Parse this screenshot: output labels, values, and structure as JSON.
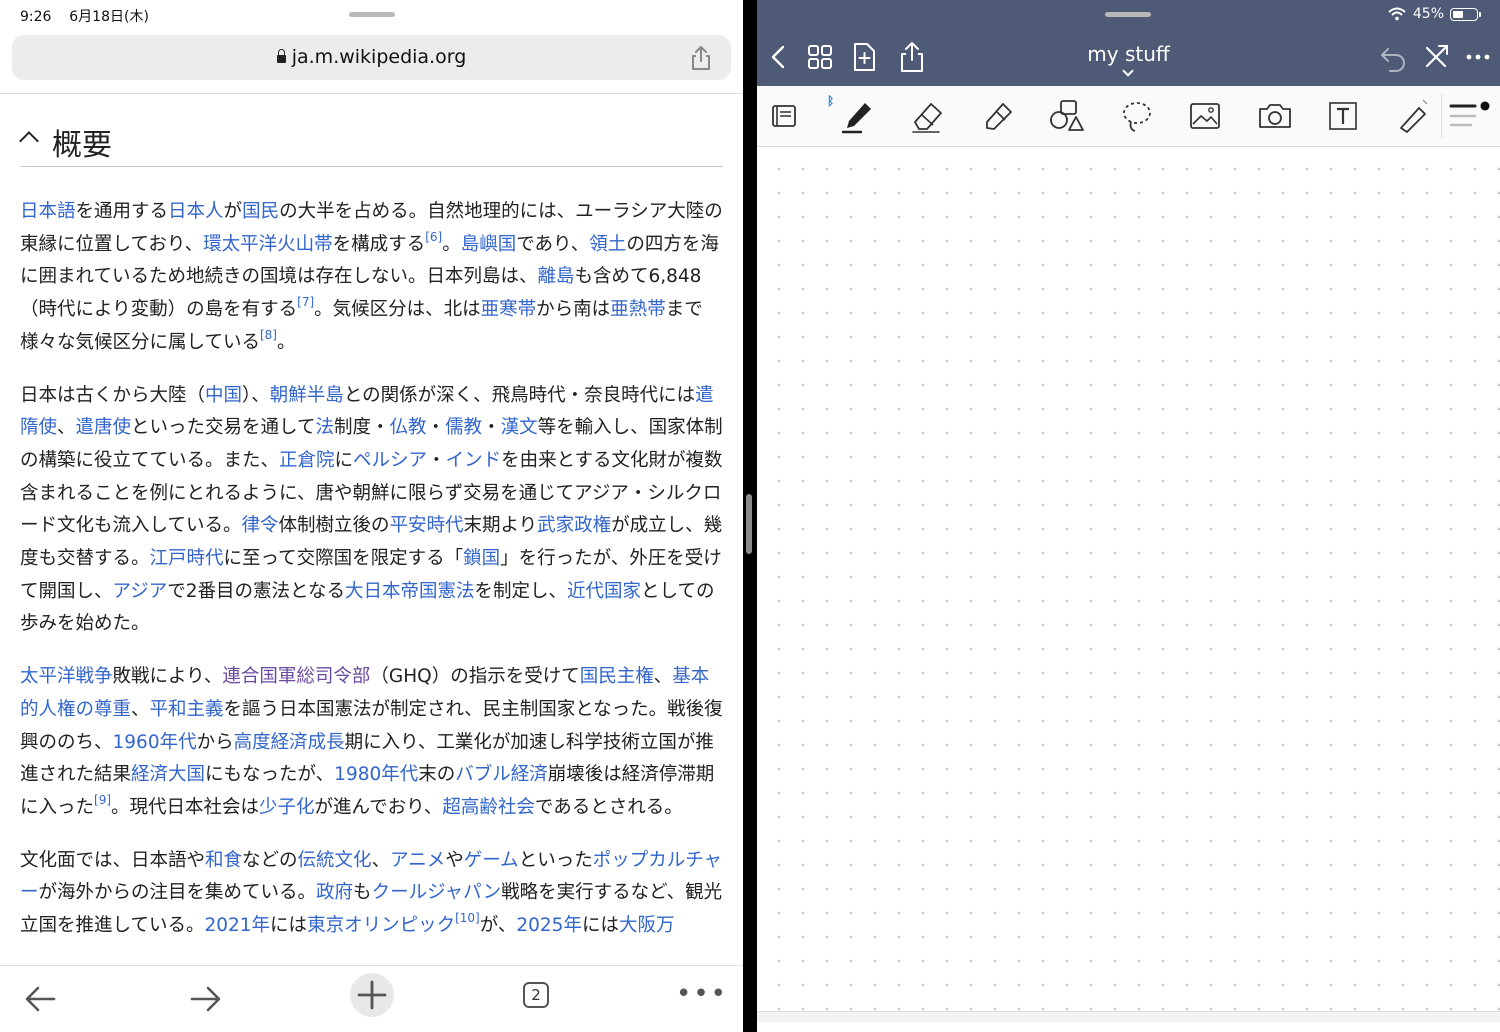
{
  "status": {
    "time": "9:26",
    "date": "6月18日(木)",
    "battery": "45%",
    "battery_level": 0.45
  },
  "browser": {
    "url": "ja.m.wikipedia.org",
    "section_title": "概要",
    "tab_count": "2",
    "paragraphs": [
      [
        {
          "t": "日本語",
          "link": true
        },
        {
          "t": "を通用する"
        },
        {
          "t": "日本人",
          "link": true
        },
        {
          "t": "が"
        },
        {
          "t": "国民",
          "link": true
        },
        {
          "t": "の大半を占める。自然地理的には、ユーラシア大陸の東縁に位置しており、"
        },
        {
          "t": "環太平洋火山帯",
          "link": true
        },
        {
          "t": "を構成する"
        },
        {
          "t": "[6]",
          "sup": true
        },
        {
          "t": "。"
        },
        {
          "t": "島嶼国",
          "link": true
        },
        {
          "t": "であり、"
        },
        {
          "t": "領土",
          "link": true
        },
        {
          "t": "の四方を海に囲まれているため地続きの国境は存在しない。日本列島は、"
        },
        {
          "t": "離島",
          "link": true
        },
        {
          "t": "も含めて6,848（時代により変動）の島を有する"
        },
        {
          "t": "[7]",
          "sup": true
        },
        {
          "t": "。気候区分は、北は"
        },
        {
          "t": "亜寒帯",
          "link": true
        },
        {
          "t": "から南は"
        },
        {
          "t": "亜熱帯",
          "link": true
        },
        {
          "t": "まで様々な気候区分に属している"
        },
        {
          "t": "[8]",
          "sup": true
        },
        {
          "t": "。"
        }
      ],
      [
        {
          "t": "日本は古くから大陸（"
        },
        {
          "t": "中国",
          "link": true
        },
        {
          "t": "）、"
        },
        {
          "t": "朝鮮半島",
          "link": true
        },
        {
          "t": "との関係が深く、飛鳥時代・奈良時代には"
        },
        {
          "t": "遣隋使",
          "link": true
        },
        {
          "t": "、"
        },
        {
          "t": "遣唐使",
          "link": true
        },
        {
          "t": "といった交易を通して"
        },
        {
          "t": "法",
          "link": true
        },
        {
          "t": "制度・"
        },
        {
          "t": "仏教",
          "link": true
        },
        {
          "t": "・"
        },
        {
          "t": "儒教",
          "link": true
        },
        {
          "t": "・"
        },
        {
          "t": "漢文",
          "link": true
        },
        {
          "t": "等を輸入し、国家体制の構築に役立てている。また、"
        },
        {
          "t": "正倉院",
          "link": true
        },
        {
          "t": "に"
        },
        {
          "t": "ペルシア",
          "link": true
        },
        {
          "t": "・"
        },
        {
          "t": "インド",
          "link": true
        },
        {
          "t": "を由来とする文化財が複数含まれることを例にとれるように、唐や朝鮮に限らず交易を通じてアジア・シルクロード文化も流入している。"
        },
        {
          "t": "律令",
          "link": true
        },
        {
          "t": "体制樹立後の"
        },
        {
          "t": "平安時代",
          "link": true
        },
        {
          "t": "末期より"
        },
        {
          "t": "武家政権",
          "link": true
        },
        {
          "t": "が成立し、幾度も交替する。"
        },
        {
          "t": "江戸時代",
          "link": true
        },
        {
          "t": "に至って交際国を限定する「"
        },
        {
          "t": "鎖国",
          "link": true
        },
        {
          "t": "」を行ったが、外圧を受けて開国し、"
        },
        {
          "t": "アジア",
          "link": true
        },
        {
          "t": "で2番目の憲法となる"
        },
        {
          "t": "大日本帝国憲法",
          "link": true
        },
        {
          "t": "を制定し、"
        },
        {
          "t": "近代国家",
          "link": true
        },
        {
          "t": "としての歩みを始めた。"
        }
      ],
      [
        {
          "t": "太平洋戦争",
          "link": true
        },
        {
          "t": "敗戦により、"
        },
        {
          "t": "連合国軍総司令部",
          "link": true,
          "visited": true
        },
        {
          "t": "（GHQ）の指示を受けて"
        },
        {
          "t": "国民主権",
          "link": true
        },
        {
          "t": "、"
        },
        {
          "t": "基本的人権の尊重",
          "link": true
        },
        {
          "t": "、"
        },
        {
          "t": "平和主義",
          "link": true
        },
        {
          "t": "を謳う日本国憲法が制定され、民主制国家となった。戦後復興ののち、"
        },
        {
          "t": "1960年代",
          "link": true
        },
        {
          "t": "から"
        },
        {
          "t": "高度経済成長",
          "link": true
        },
        {
          "t": "期に入り、工業化が加速し科学技術立国が推進された結果"
        },
        {
          "t": "経済大国",
          "link": true
        },
        {
          "t": "にもなったが、"
        },
        {
          "t": "1980年代",
          "link": true
        },
        {
          "t": "末の"
        },
        {
          "t": "バブル経済",
          "link": true
        },
        {
          "t": "崩壊後は経済停滞期に入った"
        },
        {
          "t": "[9]",
          "sup": true
        },
        {
          "t": "。現代日本社会は"
        },
        {
          "t": "少子化",
          "link": true
        },
        {
          "t": "が進んでおり、"
        },
        {
          "t": "超高齢社会",
          "link": true
        },
        {
          "t": "であるとされる。"
        }
      ],
      [
        {
          "t": "文化面では、日本語や"
        },
        {
          "t": "和食",
          "link": true
        },
        {
          "t": "などの"
        },
        {
          "t": "伝統文化",
          "link": true
        },
        {
          "t": "、"
        },
        {
          "t": "アニメ",
          "link": true
        },
        {
          "t": "や"
        },
        {
          "t": "ゲーム",
          "link": true
        },
        {
          "t": "といった"
        },
        {
          "t": "ポップカルチャー",
          "link": true
        },
        {
          "t": "が海外からの注目を集めている。"
        },
        {
          "t": "政府",
          "link": true
        },
        {
          "t": "も"
        },
        {
          "t": "クールジャパン",
          "link": true
        },
        {
          "t": "戦略を実行するなど、観光立国を推進している。"
        },
        {
          "t": "2021年",
          "link": true
        },
        {
          "t": "には"
        },
        {
          "t": "東京オリンピック",
          "link": true
        },
        {
          "t": "[10]",
          "sup": true
        },
        {
          "t": "が、"
        },
        {
          "t": "2025年",
          "link": true
        },
        {
          "t": "には"
        },
        {
          "t": "大阪万",
          "link": true
        }
      ]
    ]
  },
  "notes": {
    "title": "my stuff",
    "nav_icons": [
      "back-icon",
      "thumbnails-grid-icon",
      "add-page-icon",
      "export-share-icon",
      "undo-icon",
      "close-icon",
      "more-icon"
    ],
    "tools": [
      "document-view-icon",
      "pen-icon",
      "eraser-icon",
      "highlighter-icon",
      "shapes-icon",
      "lasso-icon",
      "image-icon",
      "camera-icon",
      "text-box-icon",
      "laser-pointer-icon",
      "pen-size-icon"
    ]
  },
  "colors": {
    "link": "#3366cc",
    "visited_link": "#6b4ba1",
    "notes_navbar": "#4f5a76",
    "bluetooth": "#2a7de1"
  }
}
